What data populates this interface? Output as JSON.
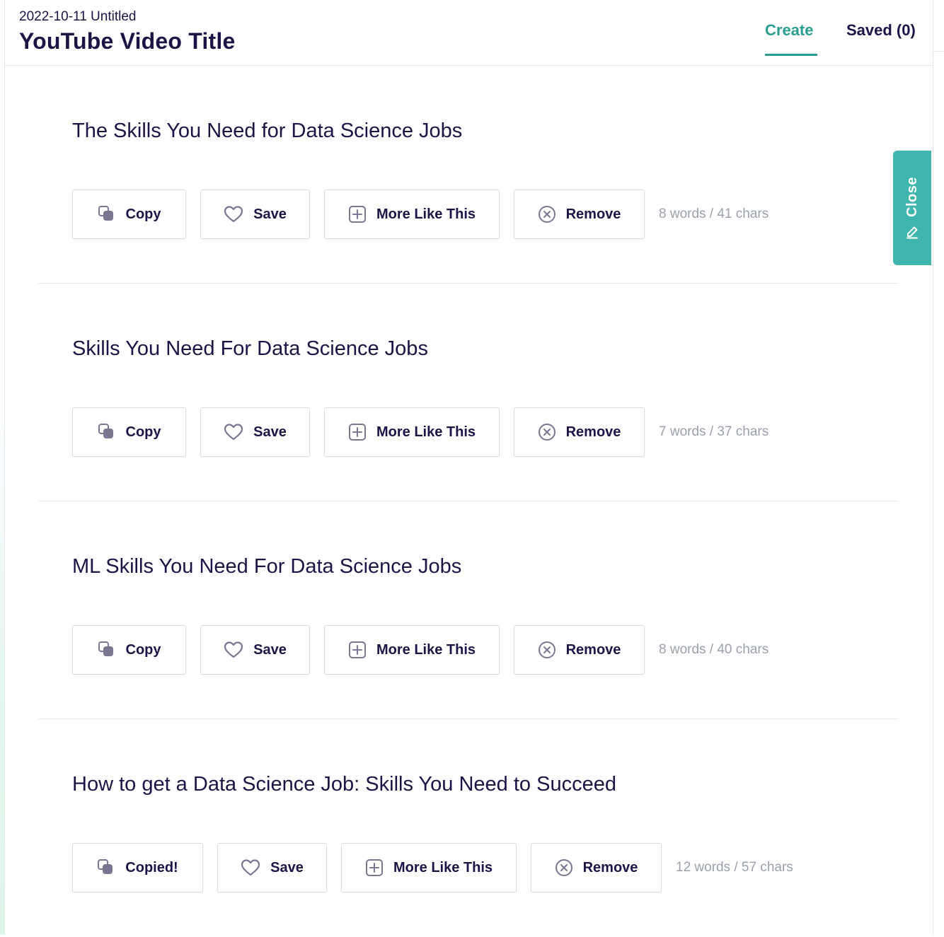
{
  "header": {
    "doc_name": "2022-10-11 Untitled",
    "doc_title": "YouTube Video Title",
    "tabs": [
      {
        "label": "Create",
        "active": true
      },
      {
        "label": "Saved (0)",
        "active": false
      }
    ]
  },
  "side_tab": {
    "label": "Close",
    "icon": "pencil-icon"
  },
  "results": [
    {
      "title": "The Skills You Need for Data Science Jobs",
      "copy_label": "Copy",
      "save_label": "Save",
      "more_label": "More Like This",
      "remove_label": "Remove",
      "count": "8 words / 41 chars"
    },
    {
      "title": "Skills You Need For Data Science Jobs",
      "copy_label": "Copy",
      "save_label": "Save",
      "more_label": "More Like This",
      "remove_label": "Remove",
      "count": "7 words / 37 chars"
    },
    {
      "title": "ML Skills You Need For Data Science Jobs",
      "copy_label": "Copy",
      "save_label": "Save",
      "more_label": "More Like This",
      "remove_label": "Remove",
      "count": "8 words / 40 chars"
    },
    {
      "title": "How to get a Data Science Job: Skills You Need to Succeed",
      "copy_label": "Copied!",
      "save_label": "Save",
      "more_label": "More Like This",
      "remove_label": "Remove",
      "count": "12 words / 57 chars"
    }
  ],
  "colors": {
    "accent": "#2a9d8f",
    "side_tab": "#3fb6ad",
    "text": "#1c1444",
    "muted": "#9aa0ab",
    "icon": "#7a7590"
  }
}
